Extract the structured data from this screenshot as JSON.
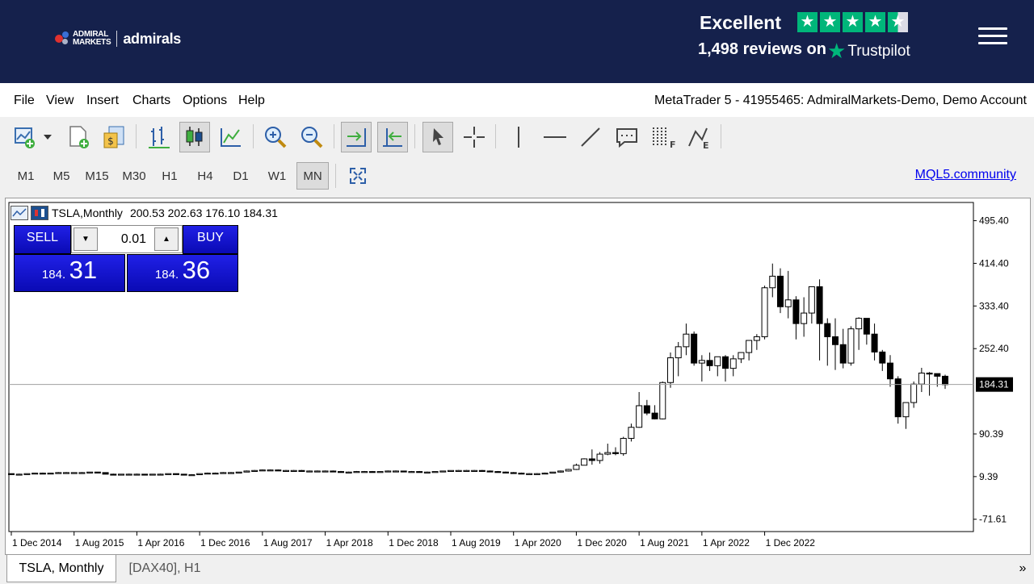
{
  "brand": {
    "line1": "ADMIRAL",
    "line2": "MARKETS",
    "word": "admirals",
    "bg": "#15214c"
  },
  "trustpilot": {
    "rating_label": "Excellent",
    "reviews": "1,498 reviews on",
    "brand": "Trustpilot",
    "stars": 4.5,
    "star_color": "#00b67a"
  },
  "menu": {
    "items": [
      "File",
      "View",
      "Insert",
      "Charts",
      "Options",
      "Help"
    ],
    "account": "MetaTrader 5 - 41955465: AdmiralMarkets-Demo, Demo Account"
  },
  "toolbar": {
    "icons": [
      "new-chart-icon",
      "dropdown-arrow-icon",
      "new-document-icon",
      "market-watch-icon",
      "bar-chart-icon",
      "candlestick-icon",
      "line-chart-icon",
      "zoom-in-icon",
      "zoom-out-icon",
      "auto-scroll-icon",
      "chart-shift-icon",
      "cursor-icon",
      "crosshair-icon",
      "vertical-line-icon",
      "horizontal-line-icon",
      "trend-line-icon",
      "text-icon",
      "fibonacci-icon",
      "fibonacci-expansion-icon"
    ]
  },
  "timeframes": {
    "items": [
      "M1",
      "M5",
      "M15",
      "M30",
      "H1",
      "H4",
      "D1",
      "W1",
      "MN"
    ],
    "selected": "MN"
  },
  "mql_link": "MQL5.community",
  "chart_header": {
    "symbol": "TSLA,Monthly",
    "ohlc": "200.53 202.63 176.10 184.31"
  },
  "trade_panel": {
    "sell_label": "SELL",
    "buy_label": "BUY",
    "lot": "0.01",
    "sell_small": "184.",
    "sell_big": "31",
    "buy_small": "184.",
    "buy_big": "36"
  },
  "chart_data": {
    "type": "candlestick",
    "symbol": "TSLA",
    "timeframe": "Monthly",
    "current_price": 184.31,
    "current_price_label": "184.31",
    "y_ticks": [
      "495.40",
      "414.40",
      "333.40",
      "252.40",
      "90.39",
      "9.39",
      "-71.61"
    ],
    "y_tick_values": [
      495.4,
      414.4,
      333.4,
      252.4,
      90.39,
      9.39,
      -71.61
    ],
    "x_ticks": [
      "1 Dec 2014",
      "1 Aug 2015",
      "1 Apr 2016",
      "1 Dec 2016",
      "1 Aug 2017",
      "1 Apr 2018",
      "1 Dec 2018",
      "1 Aug 2019",
      "1 Apr 2020",
      "1 Dec 2020",
      "1 Aug 2021",
      "1 Apr 2022",
      "1 Dec 2022"
    ],
    "ylim": [
      -95,
      530
    ],
    "candles": [
      [
        15,
        15,
        14,
        14
      ],
      [
        14,
        15,
        13,
        14
      ],
      [
        14,
        15,
        14,
        15
      ],
      [
        15,
        16,
        15,
        16
      ],
      [
        16,
        17,
        15,
        15
      ],
      [
        15,
        16,
        15,
        16
      ],
      [
        16,
        18,
        16,
        17
      ],
      [
        17,
        18,
        16,
        17
      ],
      [
        17,
        17,
        16,
        17
      ],
      [
        17,
        18,
        16,
        17
      ],
      [
        17,
        18,
        17,
        18
      ],
      [
        18,
        18,
        16,
        17
      ],
      [
        17,
        17,
        15,
        14
      ],
      [
        14,
        15,
        13,
        13
      ],
      [
        13,
        14,
        13,
        14
      ],
      [
        14,
        15,
        13,
        14
      ],
      [
        14,
        15,
        13,
        14
      ],
      [
        14,
        14,
        13,
        13
      ],
      [
        13,
        14,
        13,
        14
      ],
      [
        14,
        15,
        13,
        14
      ],
      [
        14,
        15,
        14,
        15
      ],
      [
        15,
        15,
        13,
        14
      ],
      [
        14,
        14,
        13,
        13
      ],
      [
        13,
        14,
        12,
        13
      ],
      [
        13,
        15,
        13,
        15
      ],
      [
        15,
        17,
        14,
        16
      ],
      [
        16,
        17,
        15,
        16
      ],
      [
        16,
        18,
        16,
        17
      ],
      [
        17,
        18,
        16,
        17
      ],
      [
        17,
        18,
        16,
        18
      ],
      [
        18,
        21,
        18,
        20
      ],
      [
        20,
        22,
        19,
        21
      ],
      [
        21,
        23,
        20,
        22
      ],
      [
        22,
        23,
        21,
        22
      ],
      [
        22,
        23,
        21,
        21
      ],
      [
        21,
        22,
        20,
        21
      ],
      [
        21,
        22,
        20,
        21
      ],
      [
        21,
        22,
        20,
        20
      ],
      [
        20,
        21,
        19,
        20
      ],
      [
        20,
        21,
        19,
        20
      ],
      [
        20,
        21,
        19,
        20
      ],
      [
        20,
        21,
        18,
        19
      ],
      [
        19,
        20,
        18,
        18
      ],
      [
        18,
        19,
        17,
        18
      ],
      [
        18,
        20,
        17,
        19
      ],
      [
        19,
        20,
        18,
        19
      ],
      [
        19,
        20,
        18,
        18
      ],
      [
        18,
        19,
        17,
        19
      ],
      [
        19,
        21,
        18,
        20
      ],
      [
        20,
        21,
        19,
        20
      ],
      [
        20,
        20,
        18,
        19
      ],
      [
        19,
        20,
        18,
        19
      ],
      [
        19,
        20,
        18,
        18
      ],
      [
        18,
        19,
        17,
        18
      ],
      [
        18,
        19,
        17,
        19
      ],
      [
        19,
        20,
        18,
        20
      ],
      [
        20,
        21,
        19,
        21
      ],
      [
        21,
        22,
        20,
        21
      ],
      [
        21,
        22,
        20,
        21
      ],
      [
        21,
        22,
        20,
        21
      ],
      [
        21,
        22,
        20,
        20
      ],
      [
        20,
        21,
        19,
        19
      ],
      [
        19,
        20,
        18,
        18
      ],
      [
        18,
        19,
        16,
        17
      ],
      [
        17,
        18,
        16,
        16
      ],
      [
        16,
        17,
        15,
        15
      ],
      [
        15,
        16,
        14,
        15
      ],
      [
        15,
        16,
        14,
        15
      ],
      [
        15,
        17,
        14,
        16
      ],
      [
        16,
        18,
        16,
        18
      ],
      [
        18,
        21,
        17,
        20
      ],
      [
        20,
        24,
        19,
        23
      ],
      [
        23,
        34,
        22,
        31
      ],
      [
        31,
        44,
        34,
        43
      ],
      [
        43,
        61,
        32,
        40
      ],
      [
        40,
        56,
        34,
        52
      ],
      [
        52,
        72,
        50,
        55
      ],
      [
        55,
        65,
        50,
        53
      ],
      [
        53,
        85,
        49,
        82
      ],
      [
        82,
        110,
        76,
        103
      ],
      [
        103,
        170,
        102,
        144
      ],
      [
        144,
        155,
        126,
        130
      ],
      [
        130,
        145,
        118,
        119
      ],
      [
        119,
        190,
        118,
        188
      ],
      [
        188,
        245,
        178,
        235
      ],
      [
        235,
        265,
        200,
        256
      ],
      [
        256,
        300,
        240,
        280
      ],
      [
        280,
        285,
        220,
        225
      ],
      [
        225,
        240,
        190,
        230
      ],
      [
        230,
        245,
        210,
        220
      ],
      [
        220,
        235,
        200,
        237
      ],
      [
        237,
        240,
        190,
        215
      ],
      [
        215,
        240,
        200,
        233
      ],
      [
        233,
        240,
        225,
        245
      ],
      [
        245,
        255,
        230,
        268
      ],
      [
        268,
        280,
        250,
        275
      ],
      [
        275,
        372,
        270,
        368
      ],
      [
        368,
        414,
        350,
        390
      ],
      [
        390,
        405,
        320,
        332
      ],
      [
        332,
        400,
        310,
        345
      ],
      [
        345,
        352,
        270,
        300
      ],
      [
        300,
        350,
        275,
        320
      ],
      [
        320,
        350,
        300,
        370
      ],
      [
        370,
        384,
        230,
        300
      ],
      [
        300,
        310,
        220,
        275
      ],
      [
        275,
        310,
        212,
        260
      ],
      [
        260,
        290,
        215,
        225
      ],
      [
        225,
        295,
        220,
        290
      ],
      [
        290,
        312,
        250,
        310
      ],
      [
        310,
        310,
        260,
        280
      ],
      [
        280,
        300,
        230,
        246
      ],
      [
        246,
        250,
        210,
        225
      ],
      [
        225,
        240,
        180,
        195
      ],
      [
        195,
        200,
        110,
        123
      ],
      [
        123,
        128,
        100,
        150
      ],
      [
        150,
        190,
        140,
        185
      ],
      [
        185,
        216,
        170,
        206
      ],
      [
        206,
        208,
        163,
        205
      ],
      [
        205,
        203,
        180,
        200
      ],
      [
        200,
        203,
        176,
        184
      ]
    ]
  },
  "tabs": {
    "items": [
      "TSLA, Monthly",
      "[DAX40], H1"
    ],
    "active": 0,
    "scroll_glyph": "»"
  }
}
